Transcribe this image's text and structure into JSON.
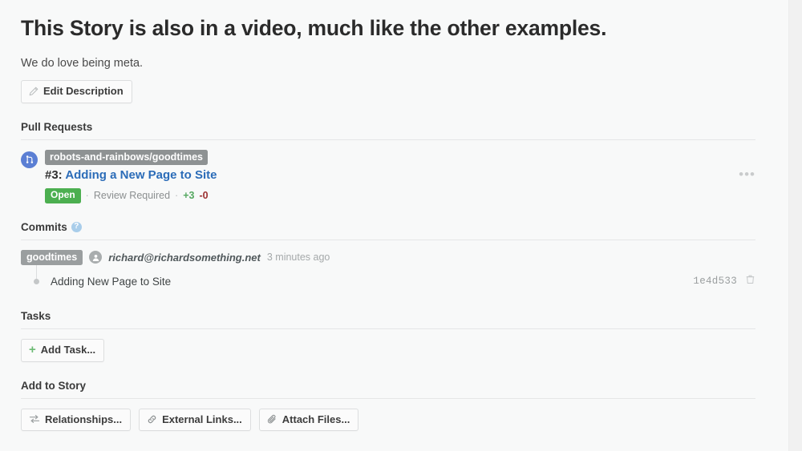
{
  "story": {
    "title": "This Story is also in a video, much like the other examples.",
    "description": "We do love being meta.",
    "edit_description_label": "Edit Description"
  },
  "pull_requests": {
    "heading": "Pull Requests",
    "items": [
      {
        "repo": "robots-and-rainbows/goodtimes",
        "number": "#3:",
        "title": "Adding a New Page to Site",
        "status": "Open",
        "review_state": "Review Required",
        "additions": "+3",
        "deletions": "-0",
        "separator": "·",
        "menu": "•••"
      }
    ]
  },
  "commits": {
    "heading": "Commits",
    "help_glyph": "?",
    "groups": [
      {
        "branch": "goodtimes",
        "author": "richard@richardsomething.net",
        "time": "3 minutes ago",
        "entries": [
          {
            "message": "Adding New Page to Site",
            "sha": "1e4d533"
          }
        ]
      }
    ]
  },
  "tasks": {
    "heading": "Tasks",
    "add_task_label": "Add Task...",
    "plus_glyph": "+"
  },
  "add_to_story": {
    "heading": "Add to Story",
    "buttons": [
      {
        "label": "Relationships...",
        "icon": "relationships-icon"
      },
      {
        "label": "External Links...",
        "icon": "link-icon"
      },
      {
        "label": "Attach Files...",
        "icon": "paperclip-icon"
      }
    ]
  },
  "colors": {
    "page_bg": "#f8f9f9",
    "link": "#2b6cb8",
    "open_badge": "#4caf50",
    "additions": "#55a861",
    "deletions": "#9c3030",
    "repo_badge": "#8e9293",
    "pr_avatar": "#5b7fd4",
    "help_icon": "#a8cdea"
  }
}
